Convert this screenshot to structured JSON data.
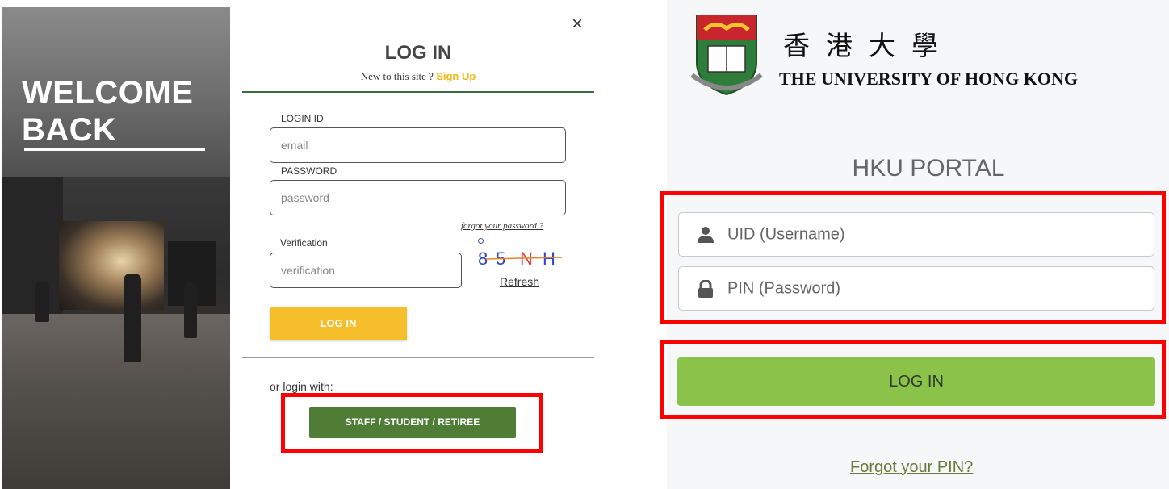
{
  "left_hero": {
    "welcome_line1": "WELCOME",
    "welcome_line2": "BACK"
  },
  "login_dialog": {
    "close_glyph": "×",
    "title": "LOG IN",
    "new_to_site": "New to this site ? ",
    "signup_link": "Sign Up",
    "login_id_label": "LOGIN ID",
    "login_id_placeholder": "email",
    "password_label": "PASSWORD",
    "password_placeholder": "password",
    "forgot_password": "forgot your password ?",
    "verification_label": "Verification",
    "verification_placeholder": "verification",
    "captcha_text": "85NH",
    "refresh_link": "Refresh",
    "login_button": "LOG IN",
    "or_login_with": "or login with:",
    "staff_button": "STAFF / STUDENT / RETIREE"
  },
  "hku_portal": {
    "chinese_name": "香港大學",
    "university_name": "THE UNIVERSITY OF HONG KONG",
    "crest_motto": "SAPIENTIA ET VIRTUS",
    "portal_title": "HKU PORTAL",
    "uid_placeholder": "UID (Username)",
    "pin_placeholder": "PIN (Password)",
    "login_button": "LOG IN",
    "forgot_pin": "Forgot your PIN?"
  },
  "colors": {
    "accent_yellow": "#f6be2a",
    "staff_green": "#4f7d36",
    "hku_green": "#8bc34a",
    "highlight_red": "#ff0000"
  },
  "icons": [
    "close-icon",
    "user-icon",
    "lock-icon",
    "crest-logo"
  ]
}
